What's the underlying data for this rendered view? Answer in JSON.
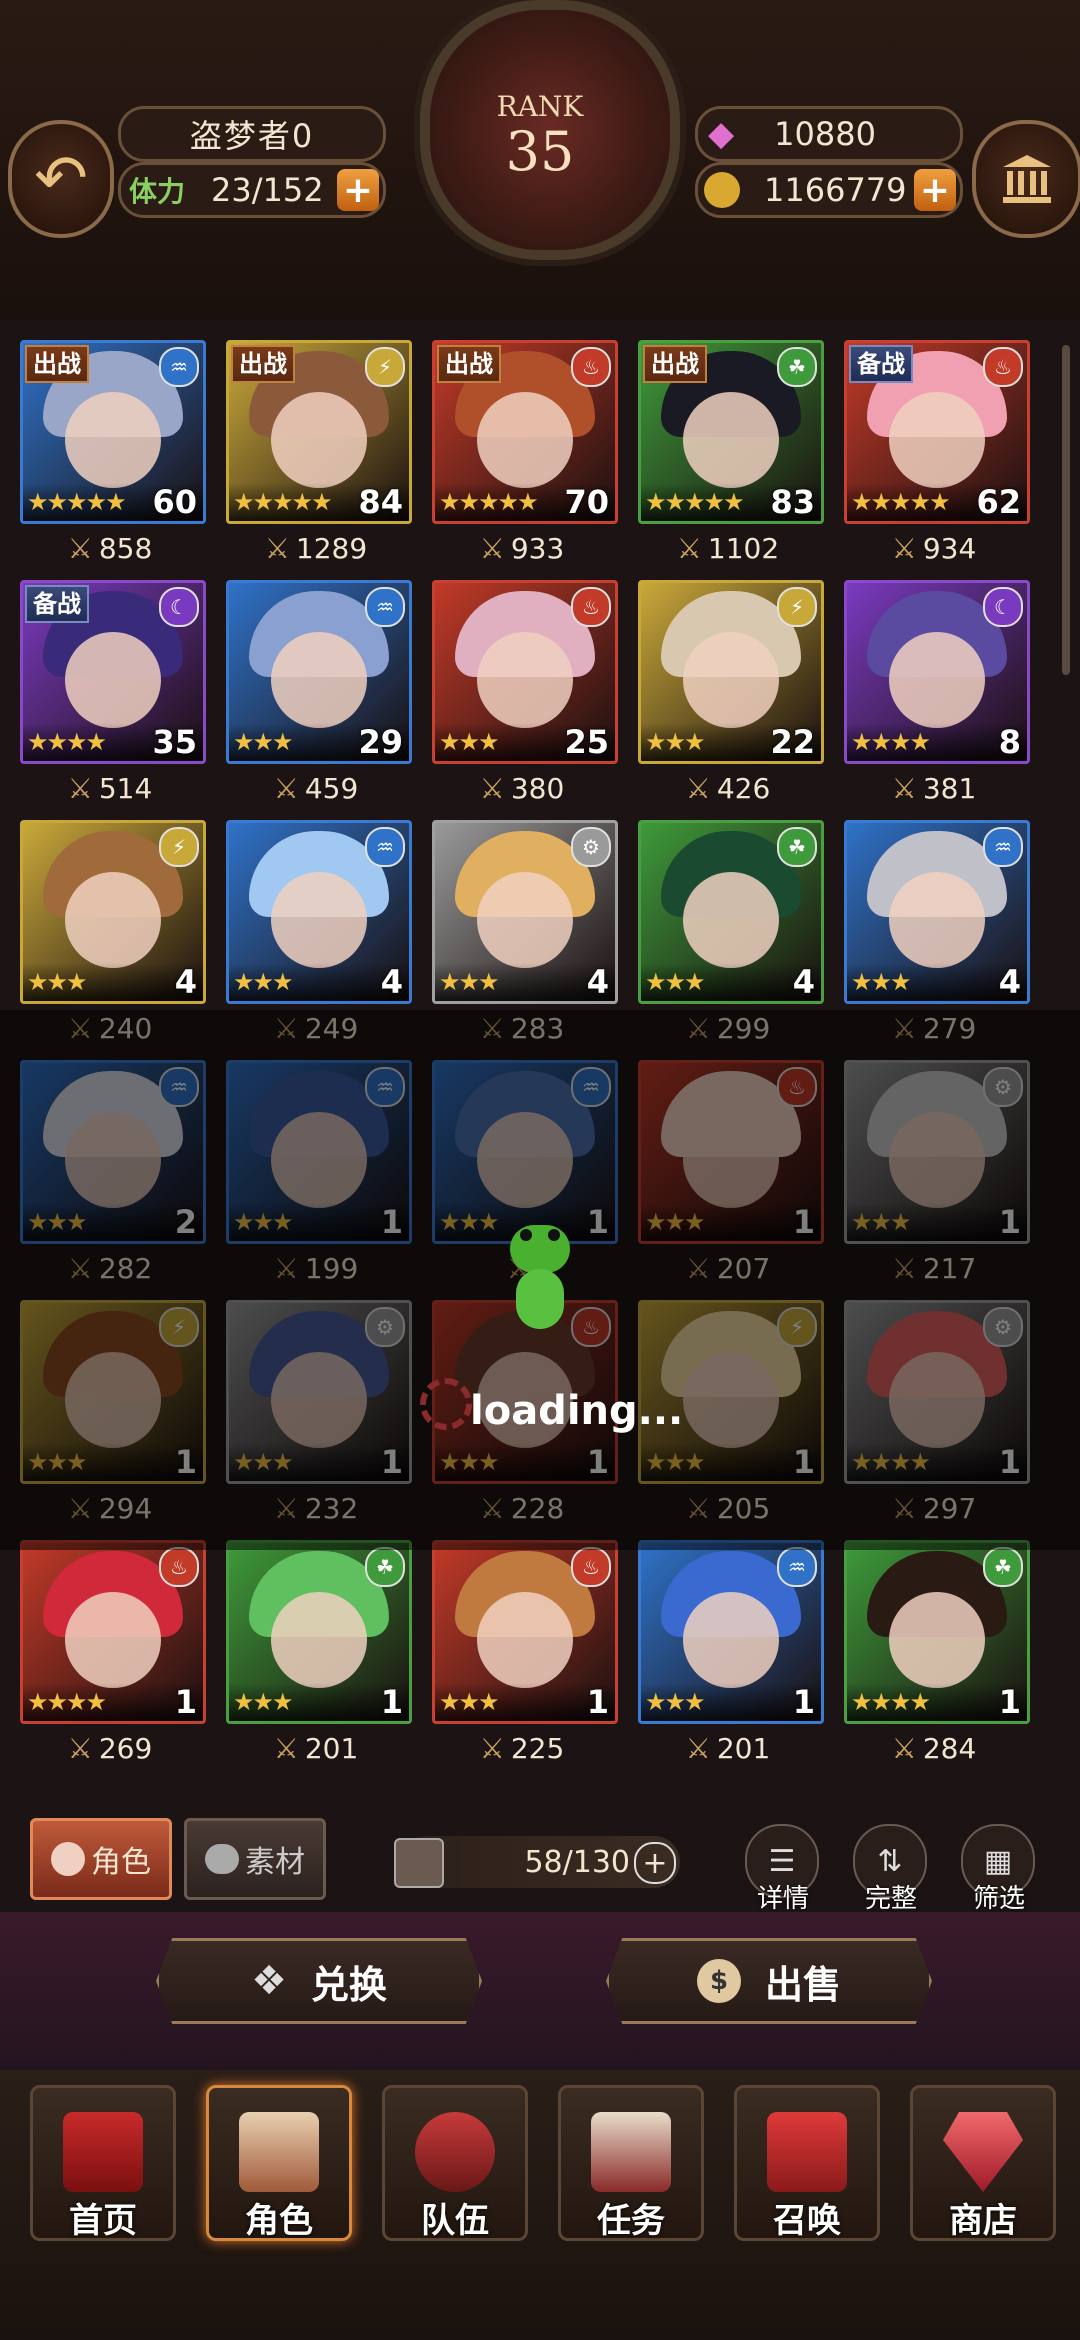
{
  "header": {
    "player_name": "盗梦者0",
    "stamina_label": "体力",
    "stamina_value": "23/152",
    "rank_label": "RANK",
    "rank_value": "35",
    "gems": "10880",
    "coins": "1166779"
  },
  "colors": {
    "accent": "#d88a3a",
    "water": "#2f72c8",
    "fire": "#c23a28",
    "light": "#c9a83a",
    "nature": "#3e9a3a",
    "dark": "#7a3ac0",
    "neutral": "#9a9a9a"
  },
  "cards": [
    {
      "element": "water",
      "badge": "出战",
      "stars": 5,
      "level": "60",
      "power": "858",
      "hair": "#9aa6c8"
    },
    {
      "element": "light",
      "badge": "出战",
      "stars": 5,
      "level": "84",
      "power": "1289",
      "hair": "#8a5a3a"
    },
    {
      "element": "fire",
      "badge": "出战",
      "stars": 5,
      "level": "70",
      "power": "933",
      "hair": "#b0502a"
    },
    {
      "element": "nature",
      "badge": "出战",
      "stars": 5,
      "level": "83",
      "power": "1102",
      "hair": "#1a1a24"
    },
    {
      "element": "fire",
      "badge": "备战",
      "stars": 5,
      "level": "62",
      "power": "934",
      "hair": "#f0a0b0"
    },
    {
      "element": "dark",
      "badge": "备战",
      "stars": 4,
      "level": "35",
      "power": "514",
      "hair": "#3a2a7a"
    },
    {
      "element": "water",
      "badge": "",
      "stars": 3,
      "level": "29",
      "power": "459",
      "hair": "#8aa0d0"
    },
    {
      "element": "fire",
      "badge": "",
      "stars": 3,
      "level": "25",
      "power": "380",
      "hair": "#e0b0c0"
    },
    {
      "element": "light",
      "badge": "",
      "stars": 3,
      "level": "22",
      "power": "426",
      "hair": "#d8c8b0"
    },
    {
      "element": "dark",
      "badge": "",
      "stars": 4,
      "level": "8",
      "power": "381",
      "hair": "#5a4aa0"
    },
    {
      "element": "light",
      "badge": "",
      "stars": 3,
      "level": "4",
      "power": "240",
      "hair": "#a06a3a"
    },
    {
      "element": "water",
      "badge": "",
      "stars": 3,
      "level": "4",
      "power": "249",
      "hair": "#a0c8f0"
    },
    {
      "element": "neutral",
      "badge": "",
      "stars": 3,
      "level": "4",
      "power": "283",
      "hair": "#e0b060"
    },
    {
      "element": "nature",
      "badge": "",
      "stars": 3,
      "level": "4",
      "power": "299",
      "hair": "#1a4a30"
    },
    {
      "element": "water",
      "badge": "",
      "stars": 3,
      "level": "4",
      "power": "279",
      "hair": "#c0c0c8"
    },
    {
      "element": "water",
      "badge": "",
      "stars": 3,
      "level": "2",
      "power": "282",
      "hair": "#d8dce8"
    },
    {
      "element": "water",
      "badge": "",
      "stars": 3,
      "level": "1",
      "power": "199",
      "hair": "#3a5aa0"
    },
    {
      "element": "water",
      "badge": "",
      "stars": 3,
      "level": "1",
      "power": "",
      "hair": "#4a70b0"
    },
    {
      "element": "fire",
      "badge": "",
      "stars": 3,
      "level": "1",
      "power": "207",
      "hair": "#f0d0c0"
    },
    {
      "element": "neutral",
      "badge": "",
      "stars": 3,
      "level": "1",
      "power": "217",
      "hair": "#c8c8c8"
    },
    {
      "element": "light",
      "badge": "",
      "stars": 3,
      "level": "1",
      "power": "294",
      "hair": "#8a4a20"
    },
    {
      "element": "neutral",
      "badge": "",
      "stars": 3,
      "level": "1",
      "power": "232",
      "hair": "#4a5a9a"
    },
    {
      "element": "fire",
      "badge": "",
      "stars": 3,
      "level": "1",
      "power": "228",
      "hair": "#6a3a2a"
    },
    {
      "element": "light",
      "badge": "",
      "stars": 3,
      "level": "1",
      "power": "205",
      "hair": "#f0d8a0"
    },
    {
      "element": "neutral",
      "badge": "",
      "stars": 4,
      "level": "1",
      "power": "297",
      "hair": "#e06060"
    },
    {
      "element": "fire",
      "badge": "",
      "stars": 4,
      "level": "1",
      "power": "269",
      "hair": "#d02a3a"
    },
    {
      "element": "nature",
      "badge": "",
      "stars": 3,
      "level": "1",
      "power": "201",
      "hair": "#60c060"
    },
    {
      "element": "fire",
      "badge": "",
      "stars": 3,
      "level": "1",
      "power": "225",
      "hair": "#c07a40"
    },
    {
      "element": "water",
      "badge": "",
      "stars": 3,
      "level": "1",
      "power": "201",
      "hair": "#3a6ad0"
    },
    {
      "element": "nature",
      "badge": "",
      "stars": 4,
      "level": "1",
      "power": "284",
      "hair": "#2a1a14"
    }
  ],
  "loading_text": "loading...",
  "toolbar": {
    "tab_character": "角色",
    "tab_material": "素材",
    "counter": "58/130",
    "details": "详情",
    "complete": "完整",
    "filter": "筛选"
  },
  "actions": {
    "exchange": "兑换",
    "sell": "出售"
  },
  "nav": {
    "home": "首页",
    "character": "角色",
    "team": "队伍",
    "quest": "任务",
    "summon": "召唤",
    "shop": "商店"
  }
}
